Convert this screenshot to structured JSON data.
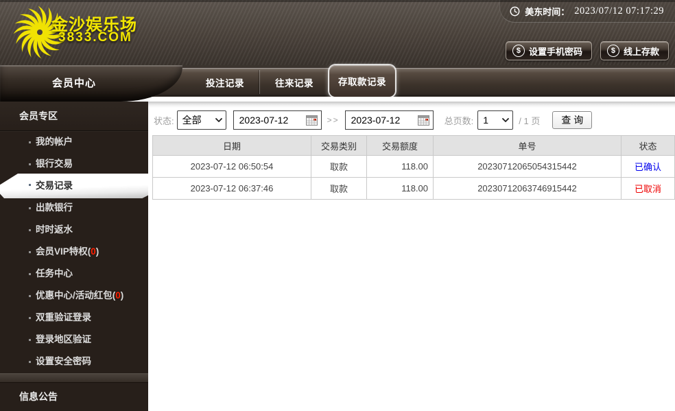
{
  "colors": {
    "accent_yellow": "#f2e600",
    "badge_red": "#ff1e00",
    "status_confirmed": "#0000ee",
    "status_cancelled": "#ee0000"
  },
  "icons": {
    "dollar": "$"
  },
  "logo": {
    "name": "金沙娱乐场",
    "domain": "3833.COM"
  },
  "topbar": {
    "time_label": "美东时间：",
    "time_value": "2023/07/12 07:17:29",
    "btn_phone_password": "设置手机密码",
    "btn_online_deposit": "线上存款"
  },
  "nav": {
    "member_center_title": "会员中心",
    "tabs": [
      {
        "label": "投注记录"
      },
      {
        "label": "往来记录"
      },
      {
        "label": "存取款记录",
        "active": true
      }
    ]
  },
  "sidebar": {
    "section_member": "会员专区",
    "items": [
      {
        "label": "我的帐户"
      },
      {
        "label": "银行交易"
      },
      {
        "label": "交易记录",
        "active": true
      },
      {
        "label": "出款银行"
      },
      {
        "label": "时时返水"
      },
      {
        "label": "会员VIP特权",
        "badge_open": "(",
        "badge_num": "0",
        "badge_close": ")"
      },
      {
        "label": "任务中心"
      },
      {
        "label": "优惠中心/活动红包",
        "badge_open": "(",
        "badge_num": "0",
        "badge_close": ")"
      },
      {
        "label": "双重验证登录"
      },
      {
        "label": "登录地区验证"
      },
      {
        "label": "设置安全密码"
      }
    ],
    "section_news": "信息公告"
  },
  "filters": {
    "status_label": "状态:",
    "status_value": "全部",
    "date_from": "2023-07-12",
    "range_separator": ">>",
    "date_to": "2023-07-12",
    "pages_label": "总页数:",
    "page_value": "1",
    "pages_total_suffix": "/ 1 页",
    "search_label": "查 询"
  },
  "table": {
    "headers": [
      "日期",
      "交易类别",
      "交易额度",
      "单号",
      "状态"
    ],
    "rows": [
      {
        "date": "2023-07-12 06:50:54",
        "type": "取款",
        "amount": "118.00",
        "order_no": "20230712065054315442",
        "status": "已确认",
        "status_color": "#0000ee"
      },
      {
        "date": "2023-07-12 06:37:46",
        "type": "取款",
        "amount": "118.00",
        "order_no": "20230712063746915442",
        "status": "已取消",
        "status_color": "#ee0000"
      }
    ]
  }
}
